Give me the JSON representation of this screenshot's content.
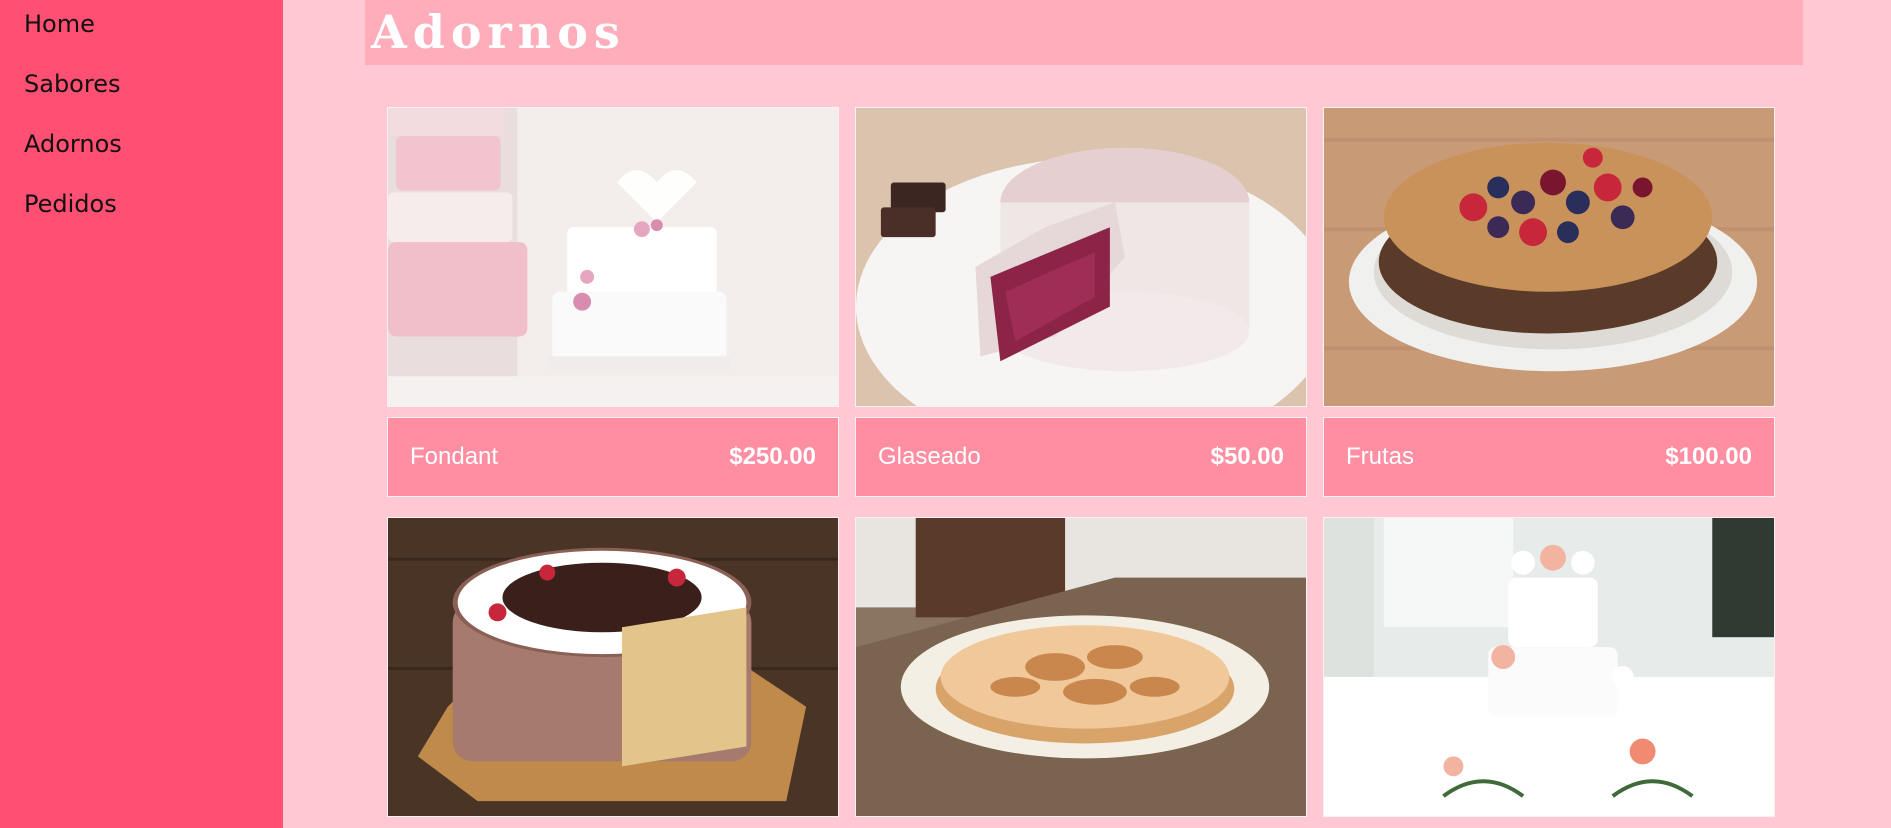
{
  "sidebar": {
    "items": [
      {
        "label": "Home"
      },
      {
        "label": "Sabores"
      },
      {
        "label": "Adornos"
      },
      {
        "label": "Pedidos"
      }
    ]
  },
  "header": {
    "title": "Adornos"
  },
  "products": [
    {
      "name": "Fondant",
      "price": "$250.00",
      "image": "white-tiered-cake"
    },
    {
      "name": "Glaseado",
      "price": "$50.00",
      "image": "red-velvet-cake"
    },
    {
      "name": "Frutas",
      "price": "$100.00",
      "image": "berry-cake"
    },
    {
      "image": "chocolate-cream-cake"
    },
    {
      "image": "meringue-pie"
    },
    {
      "image": "floral-wedding-cake"
    }
  ],
  "colors": {
    "sidebar": "#ff4f72",
    "page_background": "#ffc8d2",
    "header": "#ffadbb",
    "price_bar": "#ff8ea2"
  }
}
